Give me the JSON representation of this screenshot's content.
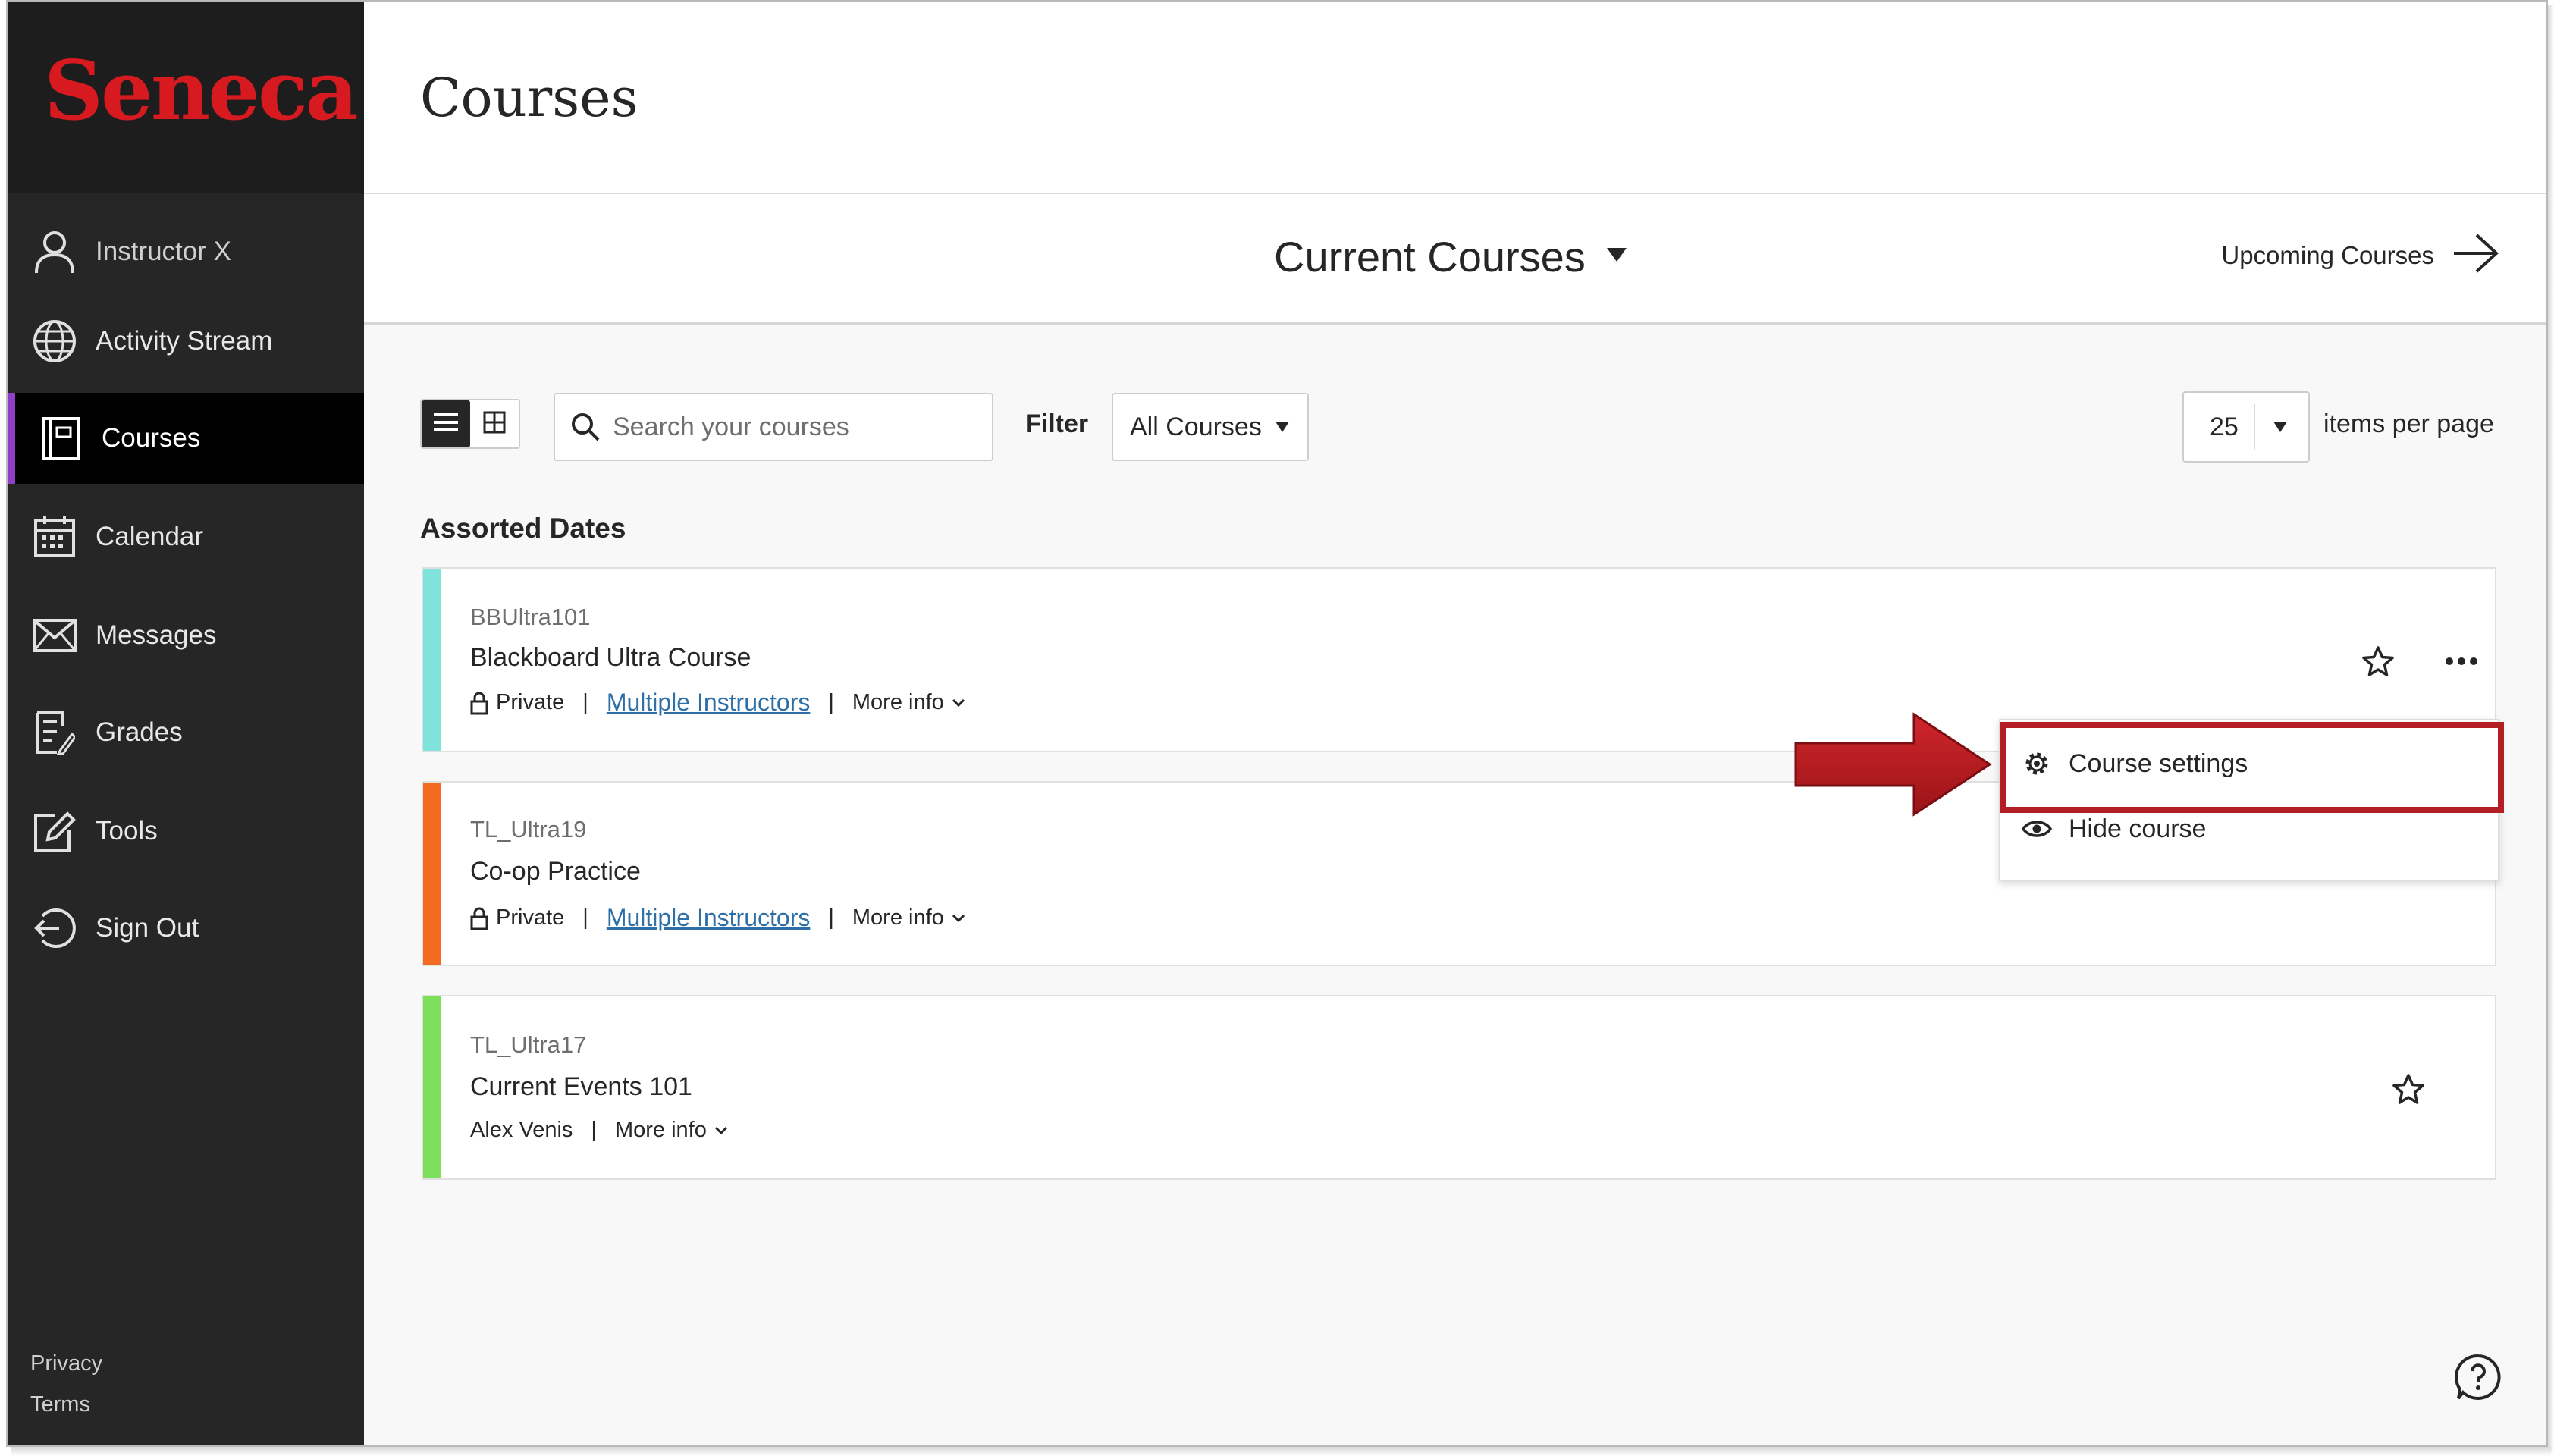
{
  "sidebar": {
    "logo": "Seneca",
    "items": [
      {
        "label": "Instructor X",
        "icon": "user-icon"
      },
      {
        "label": "Activity Stream",
        "icon": "globe-icon"
      },
      {
        "label": "Courses",
        "icon": "courses-icon",
        "active": true
      },
      {
        "label": "Calendar",
        "icon": "calendar-icon"
      },
      {
        "label": "Messages",
        "icon": "envelope-icon"
      },
      {
        "label": "Grades",
        "icon": "grades-icon"
      },
      {
        "label": "Tools",
        "icon": "tools-icon"
      },
      {
        "label": "Sign Out",
        "icon": "sign-out-icon"
      }
    ],
    "footer": {
      "privacy": "Privacy",
      "terms": "Terms"
    }
  },
  "header": {
    "title": "Courses",
    "current_term": "Current Courses",
    "upcoming": "Upcoming Courses"
  },
  "toolbar": {
    "search_placeholder": "Search your courses",
    "filter_label": "Filter",
    "filter_value": "All Courses",
    "per_page_value": "25",
    "per_page_label": "items per page"
  },
  "section": {
    "title": "Assorted Dates"
  },
  "courses": [
    {
      "code": "BBUltra101",
      "name": "Blackboard Ultra Course",
      "privacy": "Private",
      "instructors": "Multiple Instructors",
      "more": "More info",
      "color": "#7fe3db"
    },
    {
      "code": "TL_Ultra19",
      "name": "Co-op Practice",
      "privacy": "Private",
      "instructors": "Multiple Instructors",
      "more": "More info",
      "color": "#f36a21"
    },
    {
      "code": "TL_Ultra17",
      "name": "Current Events 101",
      "instructor": "Alex Venis",
      "more": "More info",
      "color": "#7ee05a"
    }
  ],
  "menu": {
    "items": [
      {
        "label": "Course settings",
        "icon": "gear-icon"
      },
      {
        "label": "Hide course",
        "icon": "eye-icon"
      }
    ]
  },
  "colors": {
    "accent": "#8f3fc7",
    "brand": "#d71920",
    "annotation": "#b21e23"
  }
}
